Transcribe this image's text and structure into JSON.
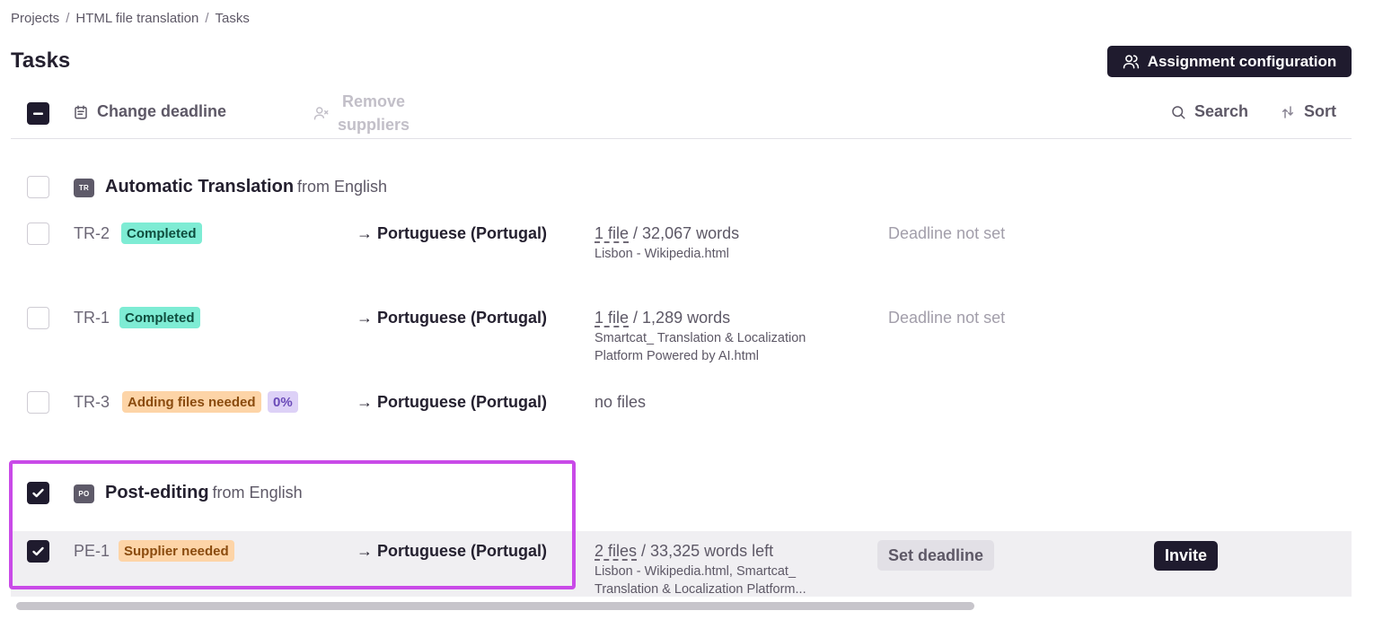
{
  "breadcrumb": {
    "items": [
      "Projects",
      "HTML file translation",
      "Tasks"
    ],
    "separator": "/"
  },
  "page_title": "Tasks",
  "header": {
    "assignment_button": "Assignment configuration"
  },
  "toolbar": {
    "change_deadline": "Change deadline",
    "remove_suppliers_line1": "Remove",
    "remove_suppliers_line2": "suppliers",
    "search": "Search",
    "sort": "Sort"
  },
  "groups": [
    {
      "icon": "TR",
      "title": "Automatic Translation",
      "from": "from English",
      "tasks": [
        {
          "id": "TR-2",
          "status": "Completed",
          "language": "→ Portuguese (Portugal)",
          "files_link": "1 file",
          "words": "/ 32,067 words",
          "file_names": "Lisbon - Wikipedia.html",
          "deadline": "Deadline not set"
        },
        {
          "id": "TR-1",
          "status": "Completed",
          "language": "→ Portuguese (Portugal)",
          "files_link": "1 file",
          "words": "/ 1,289 words",
          "file_names": "Smartcat_ Translation & Localization Platform Powered by AI.html",
          "deadline": "Deadline not set"
        },
        {
          "id": "TR-3",
          "status": "Adding files needed",
          "progress": "0%",
          "language": "→ Portuguese (Portugal)",
          "files_text": "no files"
        }
      ]
    },
    {
      "icon": "PO",
      "title": "Post-editing",
      "from": "from English",
      "tasks": [
        {
          "id": "PE-1",
          "status": "Supplier needed",
          "language": "→ Portuguese (Portugal)",
          "files_link": "2 files",
          "words": "/ 33,325 words left",
          "file_names": "Lisbon - Wikipedia.html, Smartcat_ Translation & Localization Platform...",
          "set_deadline": "Set deadline",
          "invite": "Invite"
        }
      ]
    }
  ],
  "colors": {
    "primary_dark": "#1f1b2e",
    "completed_badge": "#7eecd4",
    "warning_badge": "#fdd4a7",
    "progress_badge": "#ddd1f7",
    "highlight_frame": "#c94ae8"
  }
}
